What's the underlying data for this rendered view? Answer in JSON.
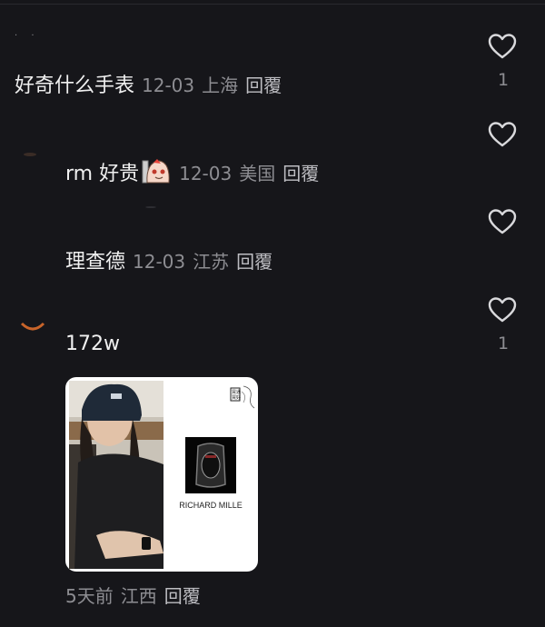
{
  "comments": [
    {
      "text": "好奇什么手表",
      "date": "12-03",
      "location": "上海",
      "reply": "回覆",
      "likes": "1"
    },
    {
      "text": "rm 好贵",
      "date": "12-03",
      "location": "美国",
      "reply": "回覆",
      "likes": ""
    },
    {
      "text": "理查德",
      "date": "12-03",
      "location": "江苏",
      "reply": "回覆",
      "likes": ""
    },
    {
      "text": "172w",
      "likes": "1",
      "image": {
        "brand_text": "RICHARD MILLE",
        "logo_text": "買通 買好"
      },
      "date": "5天前",
      "location": "江西",
      "reply": "回覆"
    }
  ],
  "colors": {
    "background": "#16161a",
    "text": "#f0f0f0",
    "meta": "#8d8d92",
    "reply": "#bdbdc2"
  }
}
